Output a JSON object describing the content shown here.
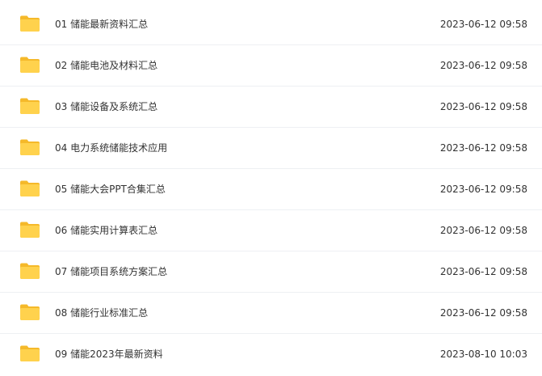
{
  "files": [
    {
      "name": "01 储能最新资料汇总",
      "modified": "2023-06-12 09:58",
      "icon": "folder-icon"
    },
    {
      "name": "02 储能电池及材料汇总",
      "modified": "2023-06-12 09:58",
      "icon": "folder-icon"
    },
    {
      "name": "03 储能设备及系统汇总",
      "modified": "2023-06-12 09:58",
      "icon": "folder-icon"
    },
    {
      "name": "04 电力系统储能技术应用",
      "modified": "2023-06-12 09:58",
      "icon": "folder-icon"
    },
    {
      "name": "05 储能大会PPT合集汇总",
      "modified": "2023-06-12 09:58",
      "icon": "folder-icon"
    },
    {
      "name": "06 储能实用计算表汇总",
      "modified": "2023-06-12 09:58",
      "icon": "folder-icon"
    },
    {
      "name": "07 储能项目系统方案汇总",
      "modified": "2023-06-12 09:58",
      "icon": "folder-icon"
    },
    {
      "name": "08 储能行业标准汇总",
      "modified": "2023-06-12 09:58",
      "icon": "folder-icon"
    },
    {
      "name": "09 储能2023年最新资料",
      "modified": "2023-08-10 10:03",
      "icon": "folder-icon"
    }
  ],
  "colors": {
    "folder_back": "#F5B92A",
    "folder_front": "#FFD24D",
    "text": "#333333",
    "divider": "#EEF0F3"
  }
}
